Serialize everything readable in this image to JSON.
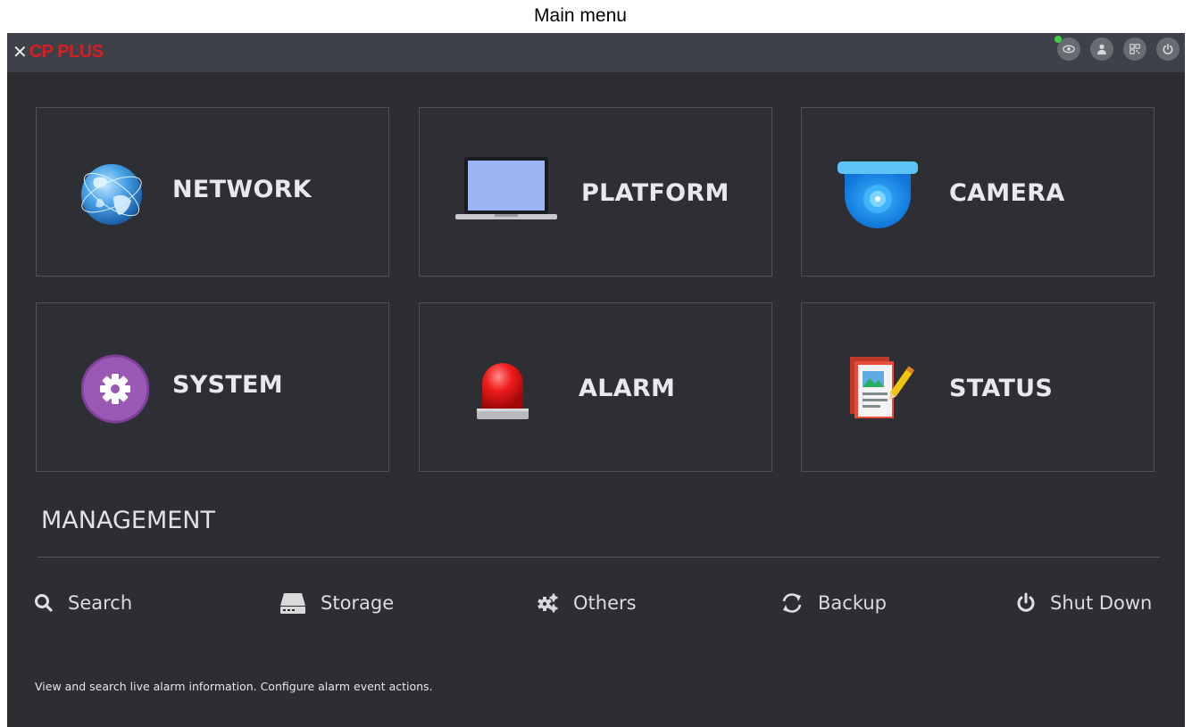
{
  "caption": "Main menu",
  "titlebar": {
    "brand": "CP PLUS",
    "brand_color": "#d41f26",
    "icons": [
      "eye-icon",
      "user-icon",
      "qr-code-icon",
      "power-icon"
    ],
    "live_indicator_color": "#3ecf45"
  },
  "tiles": [
    {
      "label": "NETWORK",
      "icon": "globe-icon"
    },
    {
      "label": "PLATFORM",
      "icon": "laptop-icon"
    },
    {
      "label": "CAMERA",
      "icon": "dome-camera-icon"
    },
    {
      "label": "SYSTEM",
      "icon": "gear-icon"
    },
    {
      "label": "ALARM",
      "icon": "siren-icon"
    },
    {
      "label": "STATUS",
      "icon": "report-pencil-icon"
    }
  ],
  "management": {
    "title": "MANAGEMENT",
    "items": [
      {
        "label": "Search",
        "icon": "search-icon"
      },
      {
        "label": "Storage",
        "icon": "hard-drive-icon"
      },
      {
        "label": "Others",
        "icon": "gears-icon"
      },
      {
        "label": "Backup",
        "icon": "refresh-icon"
      },
      {
        "label": "Shut Down",
        "icon": "power-icon"
      }
    ]
  },
  "hint": "View and search live alarm information. Configure alarm event actions."
}
